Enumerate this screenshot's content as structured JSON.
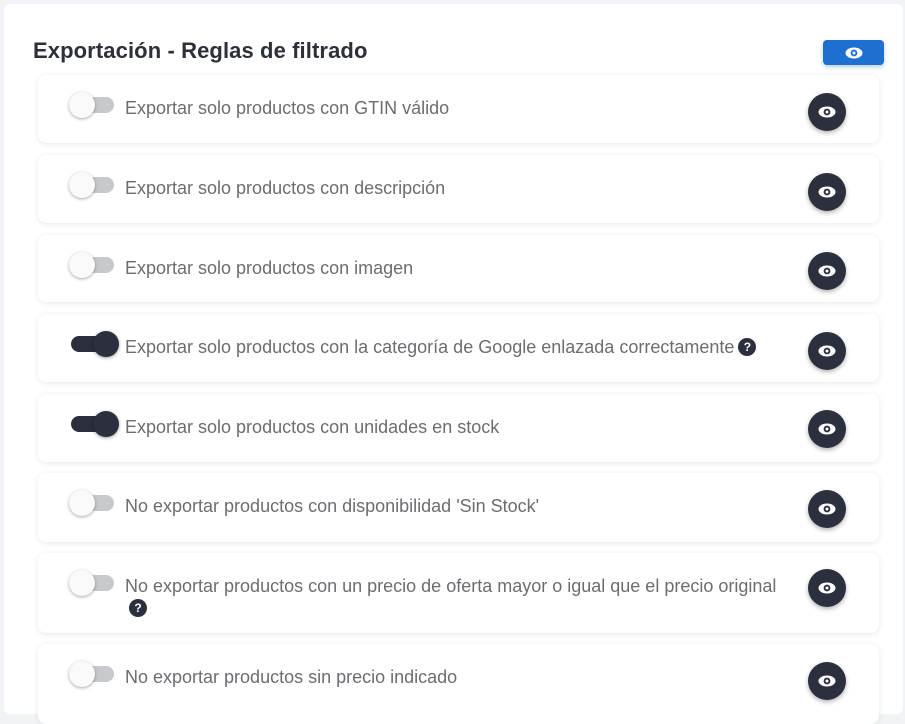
{
  "section": {
    "title": "Exportación - Reglas de filtrado",
    "accent_color": "#1f6fd1"
  },
  "rules": [
    {
      "label": "Exportar solo productos con GTIN válido",
      "enabled": false,
      "help": ""
    },
    {
      "label": "Exportar solo productos con descripción",
      "enabled": false,
      "help": ""
    },
    {
      "label": "Exportar solo productos con imagen",
      "enabled": false,
      "help": ""
    },
    {
      "label": "Exportar solo productos con la categoría de Google enlazada correctamente",
      "enabled": true,
      "help": "?"
    },
    {
      "label": "Exportar solo productos con unidades en stock",
      "enabled": true,
      "help": ""
    },
    {
      "label": "No exportar productos con disponibilidad 'Sin Stock'",
      "enabled": false,
      "help": ""
    },
    {
      "label": "No exportar productos con un precio de oferta mayor o igual que el precio original",
      "enabled": false,
      "help": "?"
    },
    {
      "label": "No exportar productos sin precio indicado",
      "enabled": false,
      "help": ""
    }
  ],
  "icons": {
    "header_button": "eye-icon",
    "row_button": "eye-icon",
    "help": "question-circle-icon"
  }
}
